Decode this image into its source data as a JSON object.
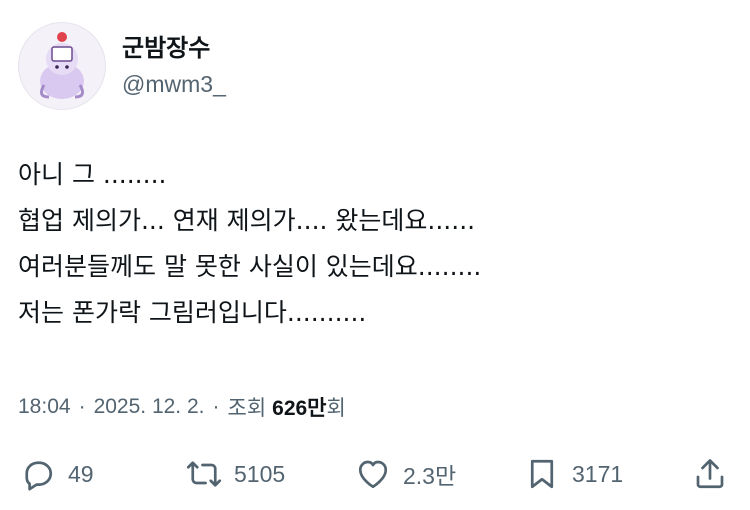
{
  "author": {
    "display_name": "군밤장수",
    "handle": "@mwm3_"
  },
  "tweet": {
    "lines": [
      "아니 그 ........",
      "협업 제의가... 연재 제의가.... 왔는데요......",
      "여러분들께도 말 못한 사실이 있는데요........",
      "저는 폰가락 그림러입니다.........."
    ]
  },
  "meta": {
    "time": "18:04",
    "separator": "·",
    "date": "2025. 12. 2.",
    "views_label_pre": "조회",
    "views_count": "626만",
    "views_label_post": "회"
  },
  "actions": {
    "replies": "49",
    "retweets": "5105",
    "likes": "2.3만",
    "bookmarks": "3171"
  },
  "icons": {
    "reply": "reply-icon",
    "retweet": "retweet-icon",
    "like": "heart-icon",
    "bookmark": "bookmark-icon",
    "share": "share-icon"
  },
  "colors": {
    "text": "#0f1419",
    "secondary": "#536471"
  }
}
